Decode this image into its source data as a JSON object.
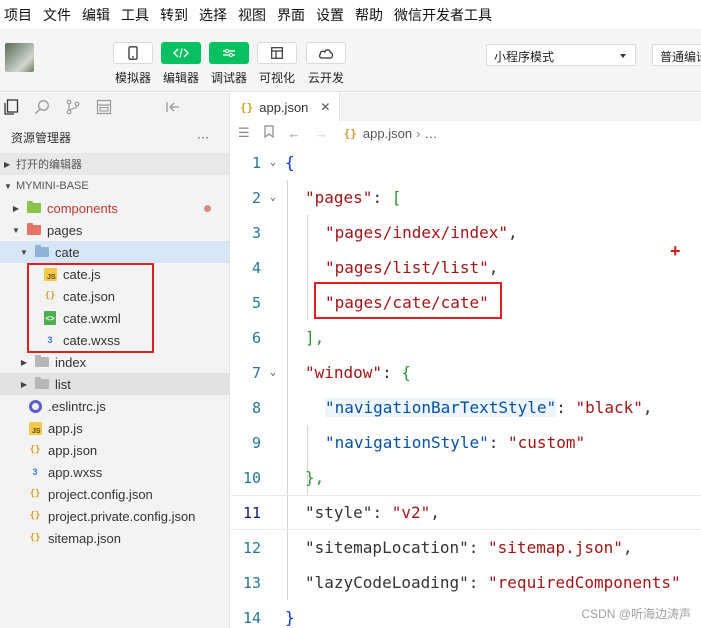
{
  "menubar": {
    "items": [
      "项目",
      "文件",
      "编辑",
      "工具",
      "转到",
      "选择",
      "视图",
      "界面",
      "设置",
      "帮助",
      "微信开发者工具"
    ]
  },
  "toolbar": {
    "tools": [
      {
        "label": "模拟器",
        "icon": "phone-icon"
      },
      {
        "label": "编辑器",
        "icon": "code-icon"
      },
      {
        "label": "调试器",
        "icon": "debug-icon"
      },
      {
        "label": "可视化",
        "icon": "layout-icon"
      },
      {
        "label": "云开发",
        "icon": "cloud-icon"
      }
    ],
    "mode_select": "小程序模式",
    "compile_select": "普通编译"
  },
  "sidebar": {
    "title": "资源管理器",
    "more": "···",
    "open_editors": "打开的编辑器",
    "project": "MYMINI-BASE",
    "tree": [
      {
        "label": "components"
      },
      {
        "label": "pages"
      },
      {
        "label": "cate"
      },
      {
        "label": "cate.js"
      },
      {
        "label": "cate.json"
      },
      {
        "label": "cate.wxml"
      },
      {
        "label": "cate.wxss"
      },
      {
        "label": "index"
      },
      {
        "label": "list"
      },
      {
        "label": ".eslintrc.js"
      },
      {
        "label": "app.js"
      },
      {
        "label": "app.json"
      },
      {
        "label": "app.wxss"
      },
      {
        "label": "project.config.json"
      },
      {
        "label": "project.private.config.json"
      },
      {
        "label": "sitemap.json"
      }
    ]
  },
  "editor": {
    "tab_label": "app.json",
    "breadcrumb_file": "app.json",
    "breadcrumb_more": "…",
    "line_numbers": [
      "1",
      "2",
      "3",
      "4",
      "5",
      "6",
      "7",
      "8",
      "9",
      "10",
      "11",
      "12",
      "13",
      "14"
    ],
    "code": {
      "l1": "{",
      "l2_key": "\"pages\"",
      "l2_rest": ": [",
      "l3": "\"pages/index/index\"",
      "l4": "\"pages/list/list\"",
      "l5": "\"pages/cate/cate\"",
      "l6": "],",
      "l7_key": "\"window\"",
      "l7_rest": ": {",
      "l8_key": "\"navigationBarTextStyle\"",
      "l8_val": "\"black\"",
      "l9_key": "\"navigationStyle\"",
      "l9_val": "\"custom\"",
      "l10": "},",
      "l11_key": "\"style\"",
      "l11_val": "\"v2\"",
      "l12_key": "\"sitemapLocation\"",
      "l12_val": "\"sitemap.json\"",
      "l13_key": "\"lazyCodeLoading\"",
      "l13_val": "\"requiredComponents\"",
      "l14": "}"
    },
    "punct": {
      "comma": ",",
      "colon": ": ",
      "plus": "+"
    }
  },
  "watermark": "CSDN @听海边涛声",
  "colors": {
    "accent": "#07c160",
    "highlight_box": "#e02020"
  }
}
